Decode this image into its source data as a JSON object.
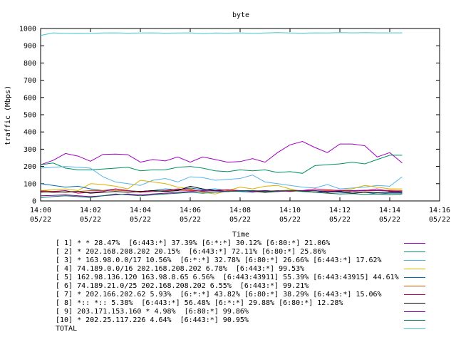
{
  "chart_data": {
    "type": "line",
    "title": "byte",
    "xlabel": "Time",
    "ylabel": "traffic (Mbps)",
    "ylim": [
      0,
      1000
    ],
    "yticks": [
      0,
      100,
      200,
      300,
      400,
      500,
      600,
      700,
      800,
      900,
      1000
    ],
    "xlim": [
      0,
      16
    ],
    "xticks": [
      {
        "v": 0,
        "time": "14:00",
        "date": "05/22"
      },
      {
        "v": 2,
        "time": "14:02",
        "date": "05/22"
      },
      {
        "v": 4,
        "time": "14:04",
        "date": "05/22"
      },
      {
        "v": 6,
        "time": "14:06",
        "date": "05/22"
      },
      {
        "v": 8,
        "time": "14:08",
        "date": "05/22"
      },
      {
        "v": 10,
        "time": "14:10",
        "date": "05/22"
      },
      {
        "v": 12,
        "time": "14:12",
        "date": "05/22"
      },
      {
        "v": 14,
        "time": "14:14",
        "date": "05/22"
      },
      {
        "v": 16,
        "time": "14:16",
        "date": "05/22"
      }
    ],
    "grid": false,
    "legend_position": "bottom",
    "x": [
      0,
      0.5,
      1,
      1.5,
      2,
      2.5,
      3,
      3.5,
      4,
      4.5,
      5,
      5.5,
      6,
      6.5,
      7,
      7.5,
      8,
      8.5,
      9,
      9.5,
      10,
      10.5,
      11,
      11.5,
      12,
      12.5,
      13,
      13.5,
      14,
      14.5
    ],
    "series": [
      {
        "name": "[ 1] * * 28.47%  [6:443:*] 37.39% [6:*:*] 30.12% [6:80:*] 21.06%",
        "color": "#a000c0",
        "values": [
          210,
          235,
          275,
          260,
          230,
          270,
          272,
          268,
          225,
          240,
          232,
          255,
          225,
          255,
          240,
          225,
          228,
          245,
          225,
          280,
          325,
          345,
          310,
          280,
          330,
          330,
          320,
          255,
          280,
          220
        ]
      },
      {
        "name": "[ 2] * 202.168.208.202 20.15%  [6:443:*] 72.11% [6:80:*] 25.86%",
        "color": "#009060",
        "values": [
          210,
          220,
          190,
          180,
          180,
          185,
          190,
          195,
          175,
          180,
          180,
          195,
          200,
          190,
          175,
          170,
          180,
          175,
          180,
          165,
          170,
          160,
          205,
          210,
          215,
          225,
          215,
          240,
          265,
          265
        ]
      },
      {
        "name": "[ 3] * 163.98.0.0/17 10.56%  [6:*:*] 32.78% [6:80:*] 26.66% [6:443:*] 17.62%",
        "color": "#56b4e9",
        "values": [
          190,
          195,
          200,
          195,
          190,
          140,
          110,
          100,
          90,
          120,
          130,
          110,
          140,
          135,
          120,
          125,
          130,
          150,
          110,
          100,
          90,
          80,
          75,
          95,
          70,
          75,
          80,
          90,
          85,
          140
        ]
      },
      {
        "name": "[ 4] 74.189.0.0/16 202.168.208.202 6.78%  [6:443:*] 99.53%",
        "color": "#e0b000",
        "values": [
          60,
          65,
          70,
          60,
          100,
          95,
          85,
          70,
          120,
          110,
          100,
          80,
          70,
          50,
          40,
          60,
          80,
          70,
          85,
          90,
          70,
          55,
          60,
          50,
          60,
          70,
          90,
          80,
          70,
          70
        ]
      },
      {
        "name": "[ 5] 162.98.136.120 163.98.8.65 6.56%  [6:443:43911] 55.39% [6:443:43915] 44.61%",
        "color": "#0070b0",
        "values": [
          100,
          90,
          80,
          85,
          70,
          60,
          70,
          60,
          55,
          60,
          70,
          65,
          75,
          65,
          70,
          60,
          55,
          50,
          60,
          55,
          60,
          58,
          50,
          55,
          50,
          45,
          50,
          40,
          45,
          45
        ]
      },
      {
        "name": "[ 6] 74.189.21.0/25 202.168.208.202 6.55%  [6:443:*] 99.21%",
        "color": "#e05000",
        "values": [
          60,
          55,
          50,
          55,
          60,
          60,
          62,
          58,
          55,
          60,
          58,
          62,
          60,
          58,
          60,
          62,
          58,
          60,
          56,
          60,
          62,
          60,
          58,
          60,
          62,
          60,
          58,
          60,
          62,
          60
        ]
      },
      {
        "name": "[ 7] * 202.166.202.62 5.93%  [6:*:*] 43.82% [6:80:*] 38.29% [6:443:*] 15.06%",
        "color": "#c00060",
        "values": [
          50,
          55,
          60,
          45,
          50,
          55,
          70,
          60,
          50,
          55,
          60,
          70,
          65,
          55,
          60,
          65,
          60,
          55,
          50,
          60,
          55,
          60,
          70,
          65,
          60,
          55,
          60,
          70,
          55,
          50
        ]
      },
      {
        "name": "[ 8] *:: *:: 5.38%  [6:443:*] 56.48% [6:*:*] 29.88% [6:80:*] 12.28%",
        "color": "#000000",
        "values": [
          55,
          50,
          52,
          55,
          45,
          50,
          55,
          50,
          55,
          60,
          55,
          60,
          85,
          70,
          60,
          55,
          58,
          60,
          50,
          55,
          60,
          58,
          60,
          50,
          55,
          45,
          50,
          48,
          50,
          50
        ]
      },
      {
        "name": "[ 9] 203.171.153.160 * 4.98%  [6:80:*] 99.86%",
        "color": "#8000a0",
        "values": [
          30,
          32,
          35,
          30,
          25,
          30,
          35,
          40,
          35,
          40,
          45,
          50,
          55,
          60,
          58,
          55,
          60,
          58,
          60,
          55,
          58,
          60,
          60,
          55,
          58,
          60,
          62,
          60,
          58,
          55
        ]
      },
      {
        "name": "[10] * 202.25.117.226 4.64%  [6:443:*] 90.95%",
        "color": "#007050",
        "values": [
          20,
          25,
          30,
          25,
          20,
          30,
          40,
          35,
          30,
          35,
          40,
          45,
          50,
          45,
          50,
          55,
          58,
          60,
          55,
          58,
          60,
          55,
          50,
          45,
          40,
          42,
          38,
          40,
          35,
          40
        ]
      },
      {
        "name": "TOTAL",
        "color": "#40c8c8",
        "values": [
          960,
          975,
          972,
          973,
          972,
          974,
          975,
          973,
          974,
          975,
          973,
          974,
          975,
          970,
          974,
          973,
          975,
          972,
          974,
          976,
          974,
          973,
          975,
          974,
          976,
          975,
          976,
          975,
          975,
          975
        ]
      }
    ]
  }
}
